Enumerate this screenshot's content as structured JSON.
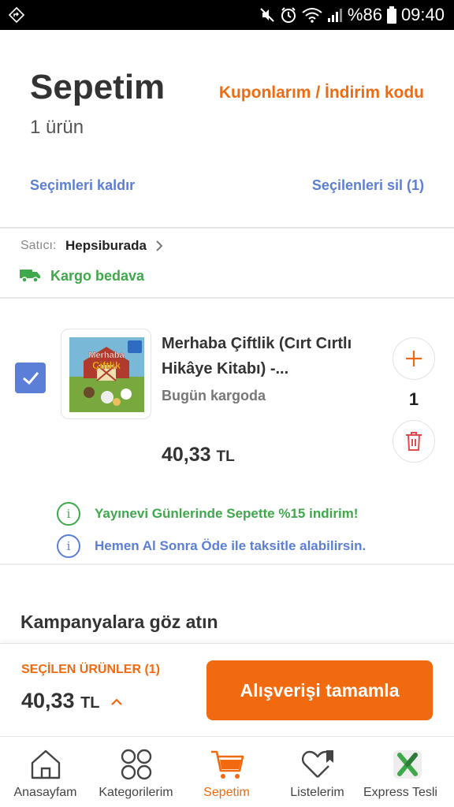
{
  "status_bar": {
    "battery": "%86",
    "time": "09:40"
  },
  "header": {
    "title": "Sepetim",
    "item_count": "1 ürün",
    "coupons_link": "Kuponlarım / İndirim kodu",
    "deselect_link": "Seçimleri kaldır",
    "delete_selected_link": "Seçilenleri sil (1)"
  },
  "seller": {
    "label": "Satıcı:",
    "name": "Hepsiburada",
    "shipping": "Kargo bedava"
  },
  "product": {
    "name": "Merhaba Çiftlik (Cırt Cırtlı Hikâye Kitabı) -...",
    "shipping_status": "Bugün kargoda",
    "price": "40,33",
    "currency": "TL",
    "quantity": "1",
    "checked": true,
    "cover_title_line1": "Merhaba",
    "cover_title_line2": "Çiftlik"
  },
  "notices": [
    {
      "text": "Yayınevi Günlerinde Sepette %15 indirim!",
      "icon": "info-icon",
      "color": "#3fa84a"
    },
    {
      "text": "Hemen Al Sonra Öde ile taksitle alabilirsin.",
      "icon": "info-icon",
      "color": "#5b7fd6"
    }
  ],
  "campaigns_heading": "Kampanyalara göz atın",
  "checkout": {
    "selected_label": "SEÇİLEN ÜRÜNLER (1)",
    "total": "40,33",
    "currency": "TL",
    "button_label": "Alışverişi tamamla"
  },
  "bottom_nav": [
    {
      "label": "Anasayfam",
      "icon": "home-icon",
      "active": false
    },
    {
      "label": "Kategorilerim",
      "icon": "categories-icon",
      "active": false
    },
    {
      "label": "Sepetim",
      "icon": "cart-icon",
      "active": true
    },
    {
      "label": "Listelerim",
      "icon": "heart-list-icon",
      "active": false
    },
    {
      "label": "Express Tesli",
      "icon": "express-icon",
      "active": false
    }
  ],
  "colors": {
    "accent": "#f26a0f",
    "link_blue": "#5b7fd6",
    "success_green": "#3fa84a"
  }
}
